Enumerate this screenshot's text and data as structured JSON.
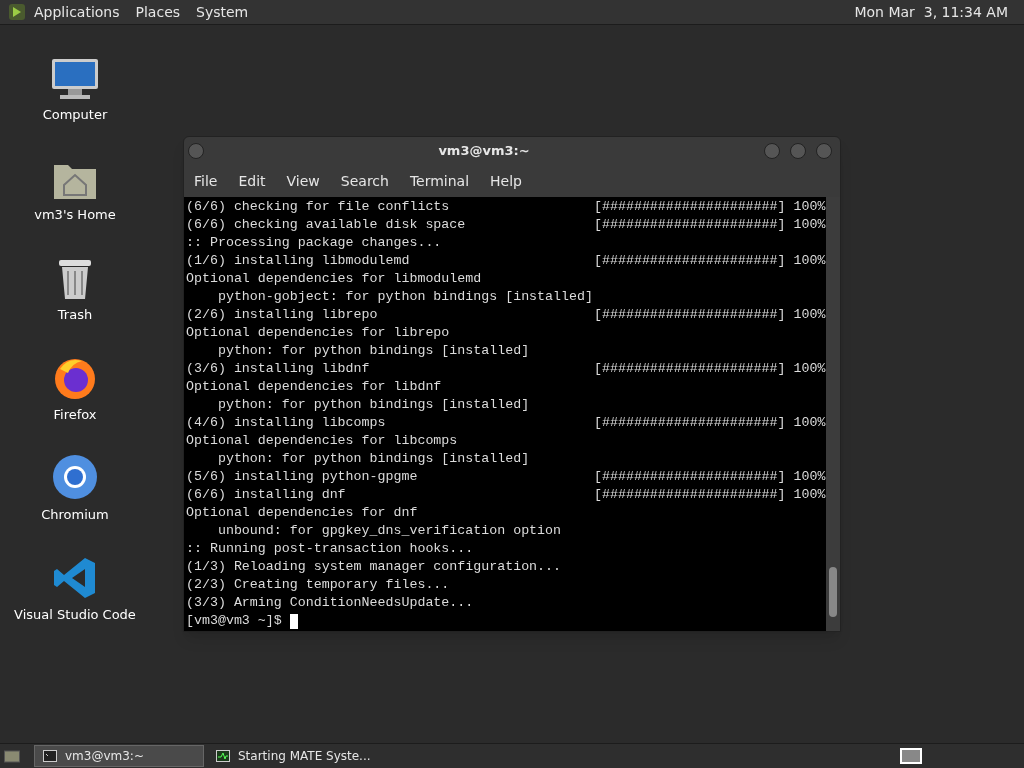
{
  "top_panel": {
    "menus": [
      "Applications",
      "Places",
      "System"
    ],
    "clock": "Mon Mar  3, 11:34 AM"
  },
  "desktop_icons": [
    {
      "kind": "computer",
      "label": "Computer"
    },
    {
      "kind": "home",
      "label": "vm3's Home"
    },
    {
      "kind": "trash",
      "label": "Trash"
    },
    {
      "kind": "firefox",
      "label": "Firefox"
    },
    {
      "kind": "chromium",
      "label": "Chromium"
    },
    {
      "kind": "vscode",
      "label": "Visual Studio Code"
    }
  ],
  "terminal": {
    "title": "vm3@vm3:~",
    "menu": [
      "File",
      "Edit",
      "View",
      "Search",
      "Terminal",
      "Help"
    ],
    "lines": [
      {
        "text": "(6/6) checking for file conflicts",
        "bar": "[######################]",
        "percent": "100%"
      },
      {
        "text": "(6/6) checking available disk space",
        "bar": "[######################]",
        "percent": "100%"
      },
      {
        "text": ":: Processing package changes..."
      },
      {
        "text": "(1/6) installing libmodulemd",
        "bar": "[######################]",
        "percent": "100%"
      },
      {
        "text": "Optional dependencies for libmodulemd"
      },
      {
        "text": "    python-gobject: for python bindings [installed]"
      },
      {
        "text": "(2/6) installing librepo",
        "bar": "[######################]",
        "percent": "100%"
      },
      {
        "text": "Optional dependencies for librepo"
      },
      {
        "text": "    python: for python bindings [installed]"
      },
      {
        "text": "(3/6) installing libdnf",
        "bar": "[######################]",
        "percent": "100%"
      },
      {
        "text": "Optional dependencies for libdnf"
      },
      {
        "text": "    python: for python bindings [installed]"
      },
      {
        "text": "(4/6) installing libcomps",
        "bar": "[######################]",
        "percent": "100%"
      },
      {
        "text": "Optional dependencies for libcomps"
      },
      {
        "text": "    python: for python bindings [installed]"
      },
      {
        "text": "(5/6) installing python-gpgme",
        "bar": "[######################]",
        "percent": "100%"
      },
      {
        "text": "(6/6) installing dnf",
        "bar": "[######################]",
        "percent": "100%"
      },
      {
        "text": "Optional dependencies for dnf"
      },
      {
        "text": "    unbound: for gpgkey_dns_verification option"
      },
      {
        "text": ":: Running post-transaction hooks..."
      },
      {
        "text": "(1/3) Reloading system manager configuration..."
      },
      {
        "text": "(2/3) Creating temporary files..."
      },
      {
        "text": "(3/3) Arming ConditionNeedsUpdate..."
      }
    ],
    "prompt": "[vm3@vm3 ~]$"
  },
  "taskbar": {
    "tasks": [
      {
        "label": "vm3@vm3:~",
        "kind": "terminal",
        "selected": true
      },
      {
        "label": "Starting MATE Syste...",
        "kind": "monitor",
        "selected": false
      }
    ]
  }
}
